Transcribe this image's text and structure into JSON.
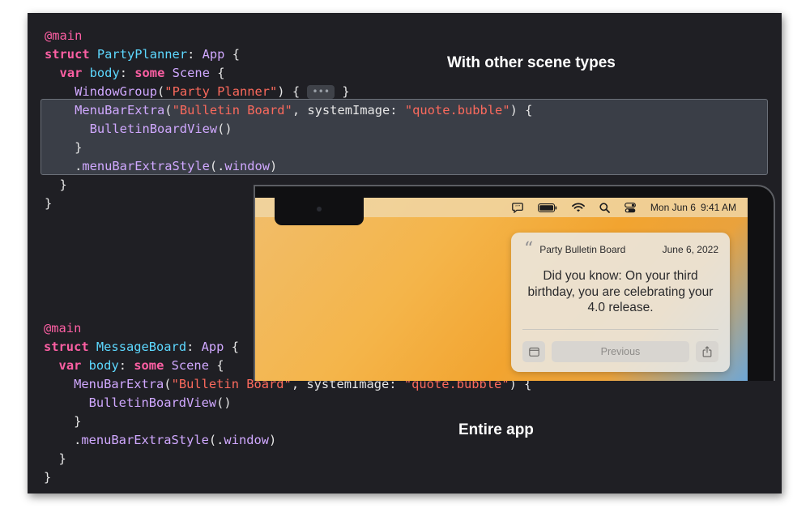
{
  "captions": {
    "top": "With other scene types",
    "bottom": "Entire app"
  },
  "code1": {
    "attr_main": "@main",
    "struct_kw": "struct",
    "name": "PartyPlanner",
    "protocol": "App",
    "var_kw": "var",
    "body": "body",
    "some_kw": "some",
    "scene": "Scene",
    "window_group": "WindowGroup",
    "window_title": "\"Party Planner\"",
    "ellipsis": "•••",
    "menu_bar_extra": "MenuBarExtra",
    "menu_title": "\"Bulletin Board\"",
    "system_image_label": "systemImage:",
    "system_image_value": "\"quote.bubble\"",
    "view": "BulletinBoardView",
    "style_modifier": "menuBarExtraStyle",
    "style_value": "window"
  },
  "code2": {
    "attr_main": "@main",
    "struct_kw": "struct",
    "name": "MessageBoard",
    "protocol": "App",
    "var_kw": "var",
    "body": "body",
    "some_kw": "some",
    "scene": "Scene",
    "menu_bar_extra": "MenuBarExtra",
    "menu_title": "\"Bulletin Board\"",
    "system_image_label": "systemImage:",
    "system_image_value": "\"quote.bubble\"",
    "view": "BulletinBoardView",
    "style_modifier": "menuBarExtraStyle",
    "style_value": "window"
  },
  "menubar": {
    "date": "Mon Jun 6",
    "time": "9:41 AM",
    "icons": [
      "quote-bubble-icon",
      "battery-icon",
      "wifi-icon",
      "search-icon",
      "control-center-icon"
    ]
  },
  "widget": {
    "title": "Party Bulletin Board",
    "date": "June 6, 2022",
    "message": "Did you know: On your third birthday, you are celebrating your 4.0 release.",
    "previous_button": "Previous"
  }
}
